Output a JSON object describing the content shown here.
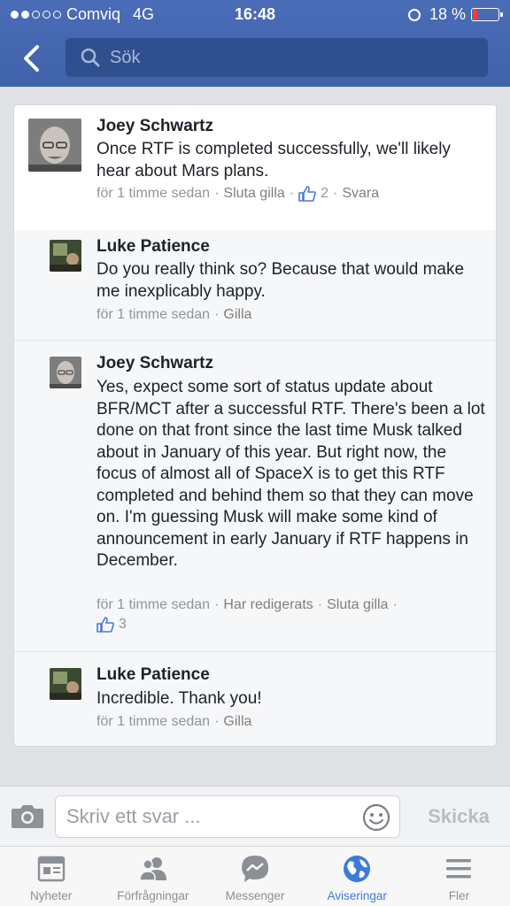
{
  "status_bar": {
    "carrier": "Comviq",
    "network": "4G",
    "time": "16:48",
    "battery": "18 %",
    "battery_level": 0.18
  },
  "header": {
    "search_placeholder": "Sök"
  },
  "comments": [
    {
      "author": "Joey Schwartz",
      "text": "Once RTF is completed successfully, we'll likely hear about Mars plans.",
      "time": "för 1 timme sedan",
      "action": "Sluta gilla",
      "likes": "2",
      "reply": "Svara"
    },
    {
      "author": "Luke Patience",
      "text": "Do you really think so? Because that would make me inexplicably happy.",
      "time": "för 1 timme sedan",
      "action": "Gilla"
    },
    {
      "author": "Joey Schwartz",
      "text": "Yes, expect some sort of status update about BFR/MCT after a successful RTF. There's been a lot done on that front since the last time Musk talked about in January of this year. But right now, the focus of almost all of SpaceX is to get this RTF completed and behind them so that they can move on. I'm guessing Musk will make some kind of announcement in early January if  RTF happens in December.",
      "time": "för 1 timme sedan",
      "edited": "Har redigerats",
      "action": "Sluta gilla",
      "likes": "3"
    },
    {
      "author": "Luke Patience",
      "text": "Incredible. Thank you!",
      "time": "för 1 timme sedan",
      "action": "Gilla"
    }
  ],
  "reply_bar": {
    "placeholder": "Skriv ett svar ...",
    "send_label": "Skicka"
  },
  "tabs": [
    {
      "label": "Nyheter",
      "icon": "news-feed-icon"
    },
    {
      "label": "Förfrågningar",
      "icon": "friend-requests-icon"
    },
    {
      "label": "Messenger",
      "icon": "messenger-icon"
    },
    {
      "label": "Aviseringar",
      "icon": "globe-icon",
      "active": true
    },
    {
      "label": "Fler",
      "icon": "menu-icon"
    }
  ],
  "colors": {
    "header": "#4267b2",
    "active_tab": "#3b7bdc",
    "like": "#4a78d8"
  }
}
